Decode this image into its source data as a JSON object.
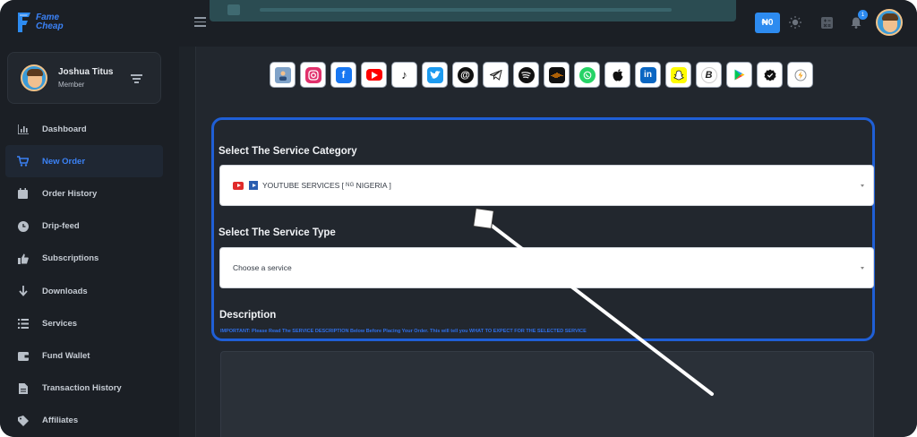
{
  "brand": {
    "name_line1": "Fame",
    "name_line2": "Cheap"
  },
  "user": {
    "name": "Joshua Titus",
    "role": "Member"
  },
  "sidebar": {
    "items": [
      {
        "label": "Dashboard",
        "icon": "chart-icon",
        "active": false
      },
      {
        "label": "New Order",
        "icon": "cart-icon",
        "active": true
      },
      {
        "label": "Order History",
        "icon": "calendar-icon",
        "active": false
      },
      {
        "label": "Drip-feed",
        "icon": "clock-icon",
        "active": false
      },
      {
        "label": "Subscriptions",
        "icon": "thumbs-up-icon",
        "active": false
      },
      {
        "label": "Downloads",
        "icon": "arrow-down-icon",
        "active": false
      },
      {
        "label": "Services",
        "icon": "list-icon",
        "active": false
      },
      {
        "label": "Fund Wallet",
        "icon": "wallet-icon",
        "active": false
      },
      {
        "label": "Transaction History",
        "icon": "document-icon",
        "active": false
      },
      {
        "label": "Affiliates",
        "icon": "percent-icon",
        "active": false
      }
    ]
  },
  "topbar": {
    "wallet_balance": "₦0",
    "notification_count": "1"
  },
  "platforms": [
    "all-services-icon",
    "instagram-icon",
    "facebook-icon",
    "youtube-icon",
    "tiktok-icon",
    "twitter-icon",
    "threads-icon",
    "telegram-icon",
    "spotify-icon",
    "audiomack-icon",
    "whatsapp-icon",
    "apple-icon",
    "linkedin-icon",
    "snapchat-icon",
    "boomplay-icon",
    "google-play-icon",
    "verified-icon",
    "other-icon"
  ],
  "form": {
    "category_label": "Select The Service Category",
    "category_value": "YOUTUBE SERVICES [",
    "category_flag": "NG",
    "category_country": "NIGERIA ]",
    "type_label": "Select The Service Type",
    "type_placeholder": "Choose a service",
    "description_label": "Description",
    "notice": "IMPORTANT: Please Read The SERVICE DESCRIPTION Below Before Placing Your Order. This will tell you WHAT TO EXPECT FOR THE SELECTED SERVICE"
  },
  "colors": {
    "accent": "#2d8bf0",
    "highlight_border": "#1f5fd6",
    "sidebar_bg": "#1b1f25",
    "main_bg": "#22272e"
  }
}
